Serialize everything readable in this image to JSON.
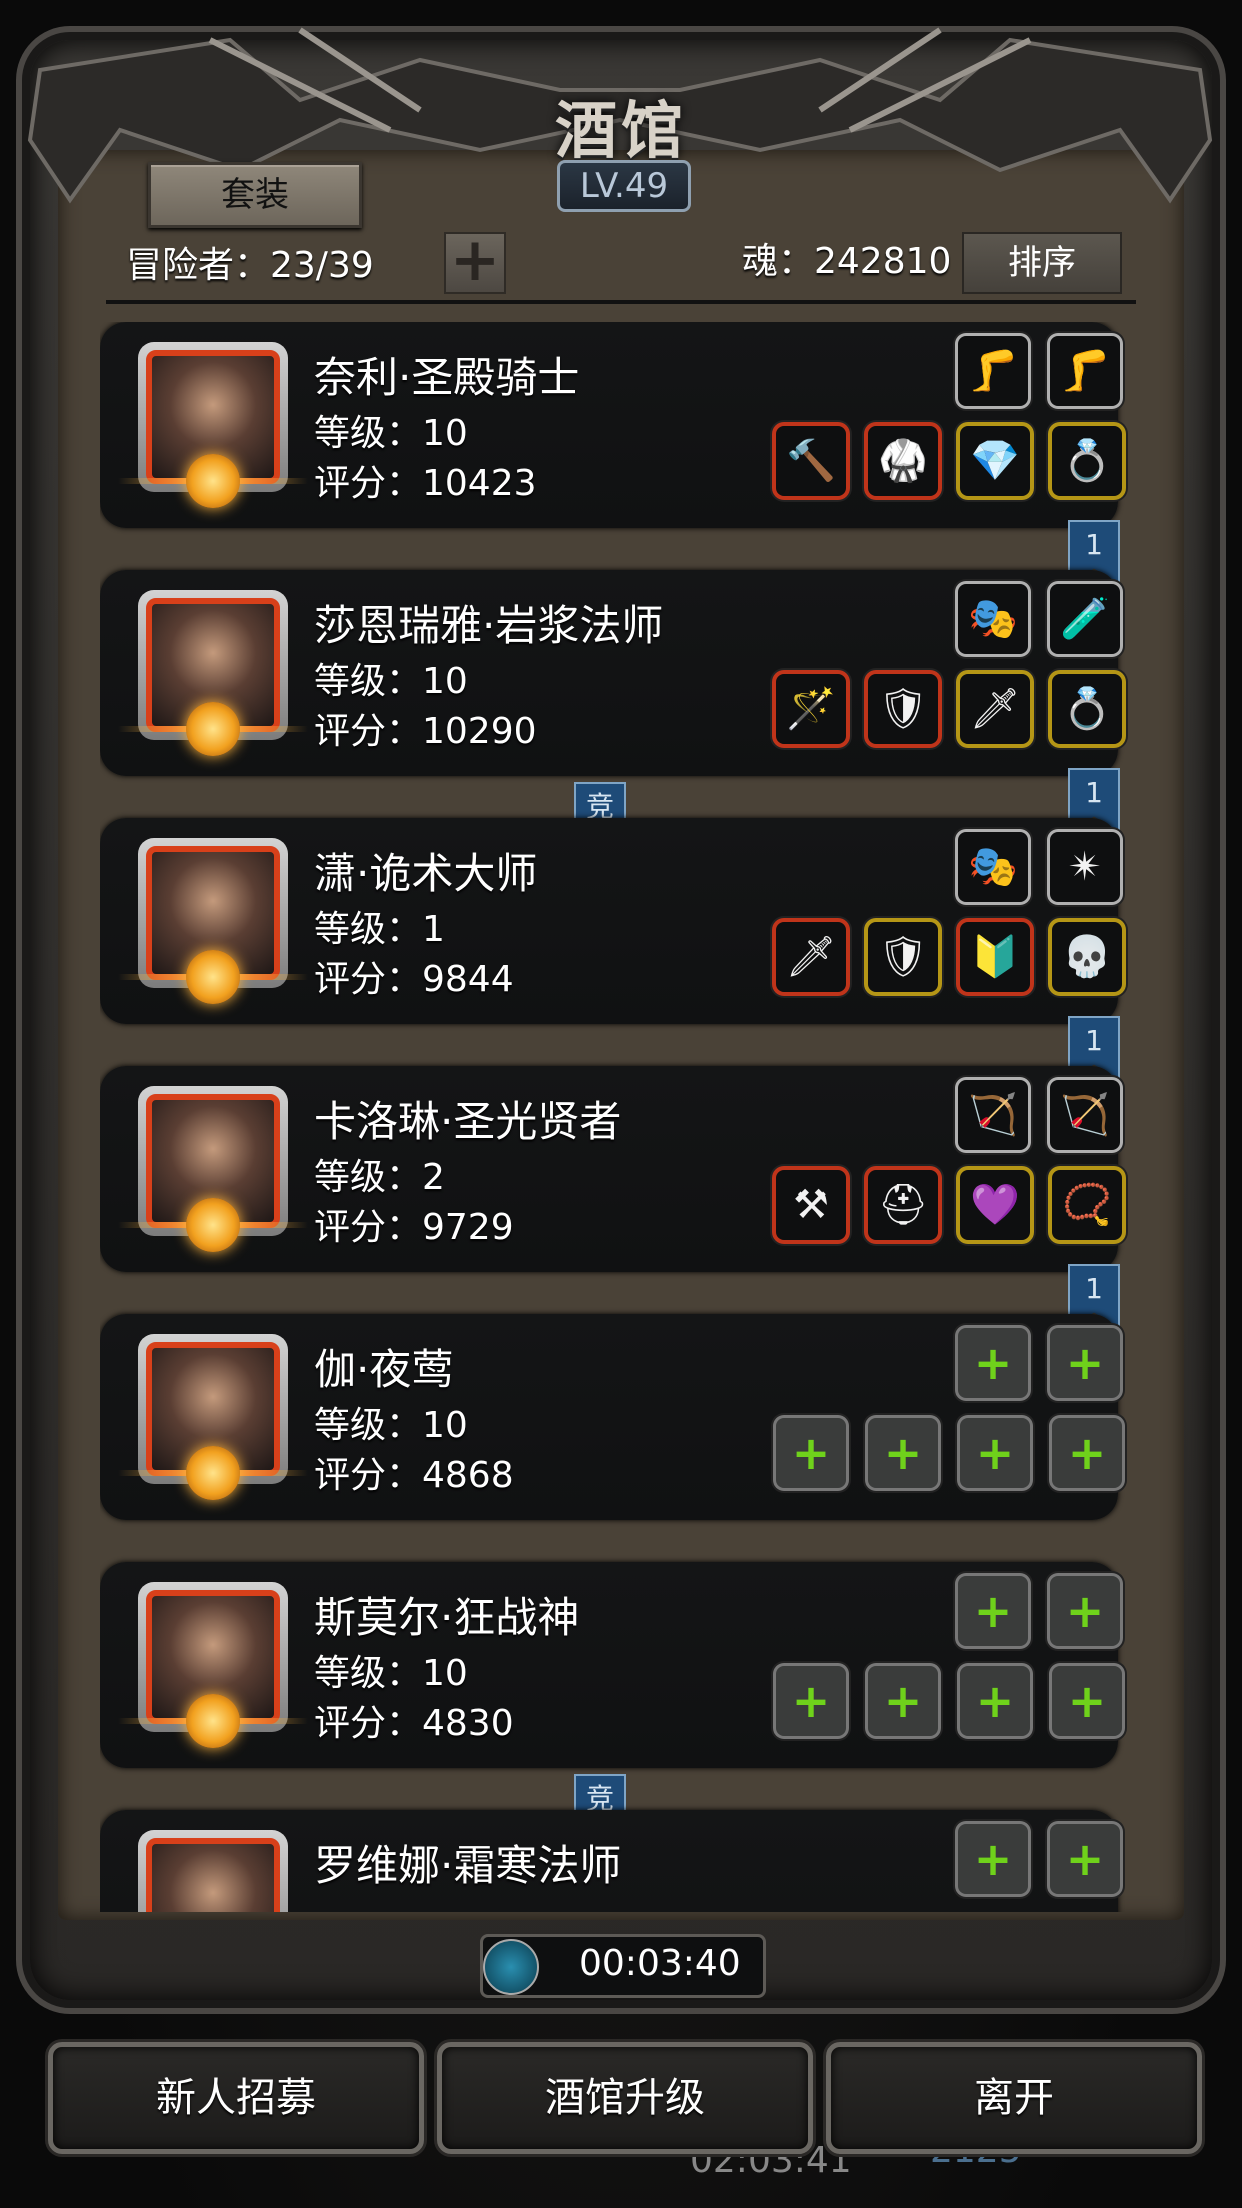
{
  "header": {
    "title": "酒馆",
    "level": "LV.49",
    "set_button": "套装",
    "adventurers": "冒险者：23/39",
    "soul": "魂：242810",
    "sort_button": "排序"
  },
  "heroes": [
    {
      "name": "奈利·圣殿骑士",
      "level": "等级：10",
      "score": "评分：10423",
      "ribbon": "1",
      "top_slots": [
        {
          "icon": "leg-armor-icon",
          "frame": "gray",
          "glyph": "🦵"
        },
        {
          "icon": "leg-armor-icon",
          "frame": "gray",
          "glyph": "🦵"
        }
      ],
      "bottom_slots": [
        {
          "icon": "hammer-icon",
          "frame": "red",
          "glyph": "🔨"
        },
        {
          "icon": "green-armor-icon",
          "frame": "red",
          "glyph": "🥋"
        },
        {
          "icon": "green-gem-icon",
          "frame": "gold",
          "glyph": "💎"
        },
        {
          "icon": "ring-icon",
          "frame": "gold",
          "glyph": "💍"
        }
      ]
    },
    {
      "name": "莎恩瑞雅·岩浆法师",
      "level": "等级：10",
      "score": "评分：10290",
      "ribbon": "1",
      "arena_badge": "竞",
      "top_slots": [
        {
          "icon": "mask-icon",
          "frame": "gray",
          "glyph": "🎭"
        },
        {
          "icon": "potion-icon",
          "frame": "gray",
          "glyph": "🧪"
        }
      ],
      "bottom_slots": [
        {
          "icon": "staff-icon",
          "frame": "red",
          "glyph": "🪄"
        },
        {
          "icon": "purple-armor-icon",
          "frame": "red",
          "glyph": "🛡"
        },
        {
          "icon": "dagger-icon",
          "frame": "gold",
          "glyph": "🗡"
        },
        {
          "icon": "gold-ring-icon",
          "frame": "gold",
          "glyph": "💍"
        }
      ]
    },
    {
      "name": "潇·诡术大师",
      "level": "等级：1",
      "score": "评分：9844",
      "ribbon": "1",
      "top_slots": [
        {
          "icon": "mask-icon",
          "frame": "gray",
          "glyph": "🎭"
        },
        {
          "icon": "amulet-icon",
          "frame": "gray",
          "glyph": "✴"
        }
      ],
      "bottom_slots": [
        {
          "icon": "sword-icon",
          "frame": "red",
          "glyph": "🗡"
        },
        {
          "icon": "gold-armor-icon",
          "frame": "gold",
          "glyph": "🛡"
        },
        {
          "icon": "shield-icon",
          "frame": "red",
          "glyph": "🔰"
        },
        {
          "icon": "skull-helm-icon",
          "frame": "gold",
          "glyph": "💀"
        }
      ]
    },
    {
      "name": "卡洛琳·圣光贤者",
      "level": "等级：2",
      "score": "评分：9729",
      "ribbon": "1",
      "top_slots": [
        {
          "icon": "bow-icon",
          "frame": "gray",
          "glyph": "🏹"
        },
        {
          "icon": "bow-icon",
          "frame": "gray",
          "glyph": "🏹"
        }
      ],
      "bottom_slots": [
        {
          "icon": "mace-icon",
          "frame": "red",
          "glyph": "⚒"
        },
        {
          "icon": "helmet-icon",
          "frame": "red",
          "glyph": "⛑"
        },
        {
          "icon": "purple-ring-icon",
          "frame": "gold",
          "glyph": "💜"
        },
        {
          "icon": "necklace-icon",
          "frame": "gold",
          "glyph": "📿"
        }
      ]
    },
    {
      "name": "伽·夜莺",
      "level": "等级：10",
      "score": "评分：4868",
      "top_slots": [
        {
          "icon": "add-slot-icon",
          "frame": "empty",
          "glyph": "+"
        },
        {
          "icon": "add-slot-icon",
          "frame": "empty",
          "glyph": "+"
        }
      ],
      "bottom_slots": [
        {
          "icon": "add-slot-icon",
          "frame": "empty",
          "glyph": "+"
        },
        {
          "icon": "add-slot-icon",
          "frame": "empty",
          "glyph": "+"
        },
        {
          "icon": "add-slot-icon",
          "frame": "empty",
          "glyph": "+"
        },
        {
          "icon": "add-slot-icon",
          "frame": "empty",
          "glyph": "+"
        }
      ]
    },
    {
      "name": "斯莫尔·狂战神",
      "level": "等级：10",
      "score": "评分：4830",
      "arena_badge": "竞",
      "top_slots": [
        {
          "icon": "add-slot-icon",
          "frame": "empty",
          "glyph": "+"
        },
        {
          "icon": "add-slot-icon",
          "frame": "empty",
          "glyph": "+"
        }
      ],
      "bottom_slots": [
        {
          "icon": "add-slot-icon",
          "frame": "empty",
          "glyph": "+"
        },
        {
          "icon": "add-slot-icon",
          "frame": "empty",
          "glyph": "+"
        },
        {
          "icon": "add-slot-icon",
          "frame": "empty",
          "glyph": "+"
        },
        {
          "icon": "add-slot-icon",
          "frame": "empty",
          "glyph": "+"
        }
      ]
    },
    {
      "name": "罗维娜·霜寒法师",
      "level": "",
      "score": "",
      "top_slots": [
        {
          "icon": "add-slot-icon",
          "frame": "empty",
          "glyph": "+"
        },
        {
          "icon": "add-slot-icon",
          "frame": "empty",
          "glyph": "+"
        }
      ],
      "bottom_slots": []
    }
  ],
  "timer": "00:03:40",
  "footer": {
    "recruit": "新人招募",
    "upgrade": "酒馆升级",
    "leave": "离开"
  },
  "background": {
    "timer": "02:03:41",
    "number": "2125"
  }
}
